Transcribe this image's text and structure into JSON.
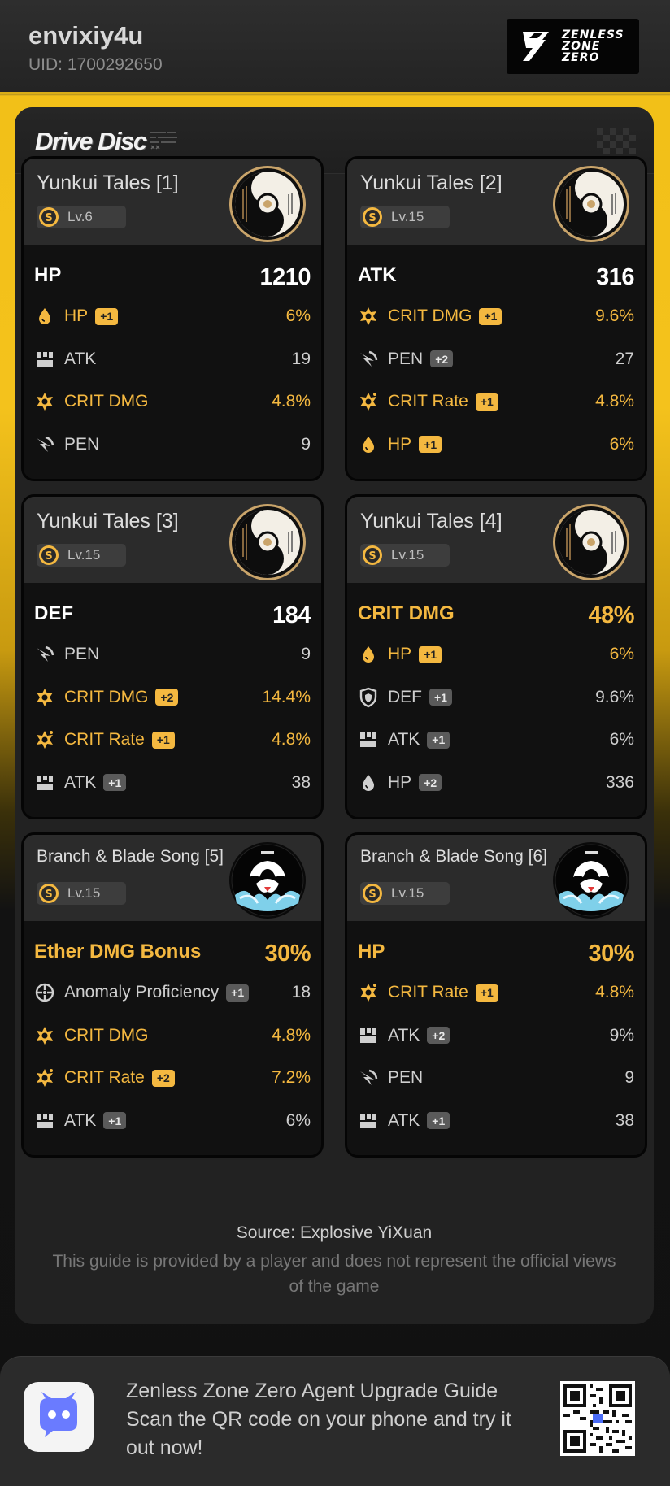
{
  "header": {
    "username": "envixiy4u",
    "uid": "UID: 1700292650",
    "logo_text": [
      "ZENLESS",
      "ZONE",
      "ZERO"
    ]
  },
  "panel": {
    "title": "Drive Disc"
  },
  "colors": {
    "accent_gold": "#f4b840",
    "background_yellow": "#f4c21c",
    "card_bg": "#111111",
    "card_top": "#2b2b2b"
  },
  "discs": [
    {
      "name": "Yunkui Tales [1]",
      "level": "Lv.6",
      "disc_art": "yunkui-tales-disc",
      "main": {
        "stat": "HP",
        "value": "1210",
        "highlight": false
      },
      "subs": [
        {
          "icon": "hp-icon",
          "name": "HP",
          "roll": "+1",
          "value": "6%",
          "highlight": true
        },
        {
          "icon": "atk-icon",
          "name": "ATK",
          "roll": "",
          "value": "19",
          "highlight": false
        },
        {
          "icon": "crit-icon",
          "name": "CRIT DMG",
          "roll": "",
          "value": "4.8%",
          "highlight": true
        },
        {
          "icon": "pen-icon",
          "name": "PEN",
          "roll": "",
          "value": "9",
          "highlight": false
        }
      ]
    },
    {
      "name": "Yunkui Tales [2]",
      "level": "Lv.15",
      "disc_art": "yunkui-tales-disc",
      "main": {
        "stat": "ATK",
        "value": "316",
        "highlight": false
      },
      "subs": [
        {
          "icon": "crit-icon",
          "name": "CRIT DMG",
          "roll": "+1",
          "value": "9.6%",
          "highlight": true
        },
        {
          "icon": "pen-icon",
          "name": "PEN",
          "roll": "+2",
          "value": "27",
          "highlight": false
        },
        {
          "icon": "crit-rate-icon",
          "name": "CRIT Rate",
          "roll": "+1",
          "value": "4.8%",
          "highlight": true
        },
        {
          "icon": "hp-icon",
          "name": "HP",
          "roll": "+1",
          "value": "6%",
          "highlight": true
        }
      ]
    },
    {
      "name": "Yunkui Tales [3]",
      "level": "Lv.15",
      "disc_art": "yunkui-tales-disc",
      "main": {
        "stat": "DEF",
        "value": "184",
        "highlight": false
      },
      "subs": [
        {
          "icon": "pen-icon",
          "name": "PEN",
          "roll": "",
          "value": "9",
          "highlight": false
        },
        {
          "icon": "crit-icon",
          "name": "CRIT DMG",
          "roll": "+2",
          "value": "14.4%",
          "highlight": true
        },
        {
          "icon": "crit-rate-icon",
          "name": "CRIT Rate",
          "roll": "+1",
          "value": "4.8%",
          "highlight": true
        },
        {
          "icon": "atk-icon",
          "name": "ATK",
          "roll": "+1",
          "value": "38",
          "highlight": false
        }
      ]
    },
    {
      "name": "Yunkui Tales [4]",
      "level": "Lv.15",
      "disc_art": "yunkui-tales-disc",
      "main": {
        "stat": "CRIT DMG",
        "value": "48%",
        "highlight": true
      },
      "subs": [
        {
          "icon": "hp-icon",
          "name": "HP",
          "roll": "+1",
          "value": "6%",
          "highlight": true
        },
        {
          "icon": "def-icon",
          "name": "DEF",
          "roll": "+1",
          "value": "9.6%",
          "highlight": false
        },
        {
          "icon": "atk-icon",
          "name": "ATK",
          "roll": "+1",
          "value": "6%",
          "highlight": false
        },
        {
          "icon": "hp-icon",
          "name": "HP",
          "roll": "+2",
          "value": "336",
          "highlight": false
        }
      ]
    },
    {
      "name": "Branch & Blade Song [5]",
      "level": "Lv.15",
      "disc_art": "branch-blade-disc",
      "main": {
        "stat": "Ether DMG Bonus",
        "value": "30%",
        "highlight": true
      },
      "subs": [
        {
          "icon": "anomaly-icon",
          "name": "Anomaly Proficiency",
          "roll": "+1",
          "value": "18",
          "highlight": false
        },
        {
          "icon": "crit-icon",
          "name": "CRIT DMG",
          "roll": "",
          "value": "4.8%",
          "highlight": true
        },
        {
          "icon": "crit-rate-icon",
          "name": "CRIT Rate",
          "roll": "+2",
          "value": "7.2%",
          "highlight": true
        },
        {
          "icon": "atk-icon",
          "name": "ATK",
          "roll": "+1",
          "value": "6%",
          "highlight": false
        }
      ]
    },
    {
      "name": "Branch & Blade Song [6]",
      "level": "Lv.15",
      "disc_art": "branch-blade-disc",
      "main": {
        "stat": "HP",
        "value": "30%",
        "highlight": true
      },
      "subs": [
        {
          "icon": "crit-rate-icon",
          "name": "CRIT Rate",
          "roll": "+1",
          "value": "4.8%",
          "highlight": true
        },
        {
          "icon": "atk-icon",
          "name": "ATK",
          "roll": "+2",
          "value": "9%",
          "highlight": false
        },
        {
          "icon": "pen-icon",
          "name": "PEN",
          "roll": "",
          "value": "9",
          "highlight": false
        },
        {
          "icon": "atk-icon",
          "name": "ATK",
          "roll": "+1",
          "value": "38",
          "highlight": false
        }
      ]
    }
  ],
  "footer": {
    "source": "Source: Explosive YiXuan",
    "note": "This guide is provided by a player and does not represent the official views of the game"
  },
  "banner": {
    "title": "Zenless Zone Zero Agent Upgrade Guide",
    "text": "Scan the QR code on your phone and try it out now!",
    "app_icon": "discord-bot-icon",
    "qr": "qr-code"
  }
}
